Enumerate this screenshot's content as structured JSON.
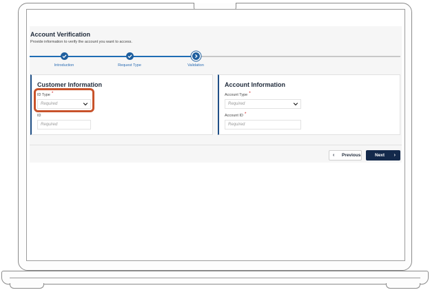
{
  "page": {
    "title": "Account Verification",
    "subtitle": "Provide information to verify the account you want to access."
  },
  "stepper": {
    "steps": [
      {
        "label": "Introduction",
        "state": "complete",
        "icon": "check-icon"
      },
      {
        "label": "Request Type",
        "state": "complete",
        "icon": "check-icon"
      },
      {
        "label": "Validation",
        "state": "current",
        "icon": "chevron-right-icon"
      }
    ]
  },
  "customer_panel": {
    "title": "Customer Information",
    "id_type": {
      "label": "ID Type",
      "required_mark": "*",
      "placeholder": "Required"
    },
    "id": {
      "label": "ID",
      "placeholder": "Required"
    }
  },
  "account_panel": {
    "title": "Account Information",
    "account_type": {
      "label": "Account Type",
      "required_mark": "*",
      "placeholder": "Required"
    },
    "account_id": {
      "label": "Account ID",
      "required_mark": "*",
      "placeholder": "Required"
    }
  },
  "actions": {
    "previous_label": "Previous",
    "previous_arrow": "‹",
    "next_label": "Next",
    "next_arrow": "›"
  },
  "colors": {
    "accent": "#1f5f9e",
    "primary_button": "#13294b",
    "highlight": "#c8532b",
    "required": "#d02020"
  }
}
